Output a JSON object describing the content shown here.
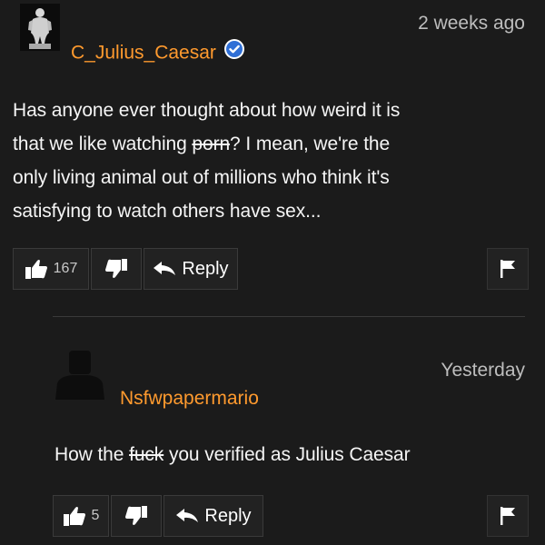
{
  "comments": [
    {
      "username": "C_Julius_Caesar",
      "verified": true,
      "timestamp": "2 weeks ago",
      "text_lines": [
        "Has anyone ever thought about how weird it is",
        "that we like watching ",
        "porn",
        "? I mean, we're the",
        "only living animal out of millions who think it's",
        "satisfying to watch others have sex..."
      ],
      "likes": "167",
      "reply_label": "Reply"
    },
    {
      "username": "Nsfwpapermario",
      "verified": false,
      "timestamp": "Yesterday",
      "text_parts": {
        "before": "How the ",
        "censored": "fuck",
        "after": " you verified as Julius Caesar"
      },
      "likes": "5",
      "reply_label": "Reply"
    }
  ],
  "colors": {
    "background": "#1b1b1b",
    "username": "#ff9a2e",
    "verified_badge": "#2f6fd6",
    "button_bg": "#222222"
  }
}
